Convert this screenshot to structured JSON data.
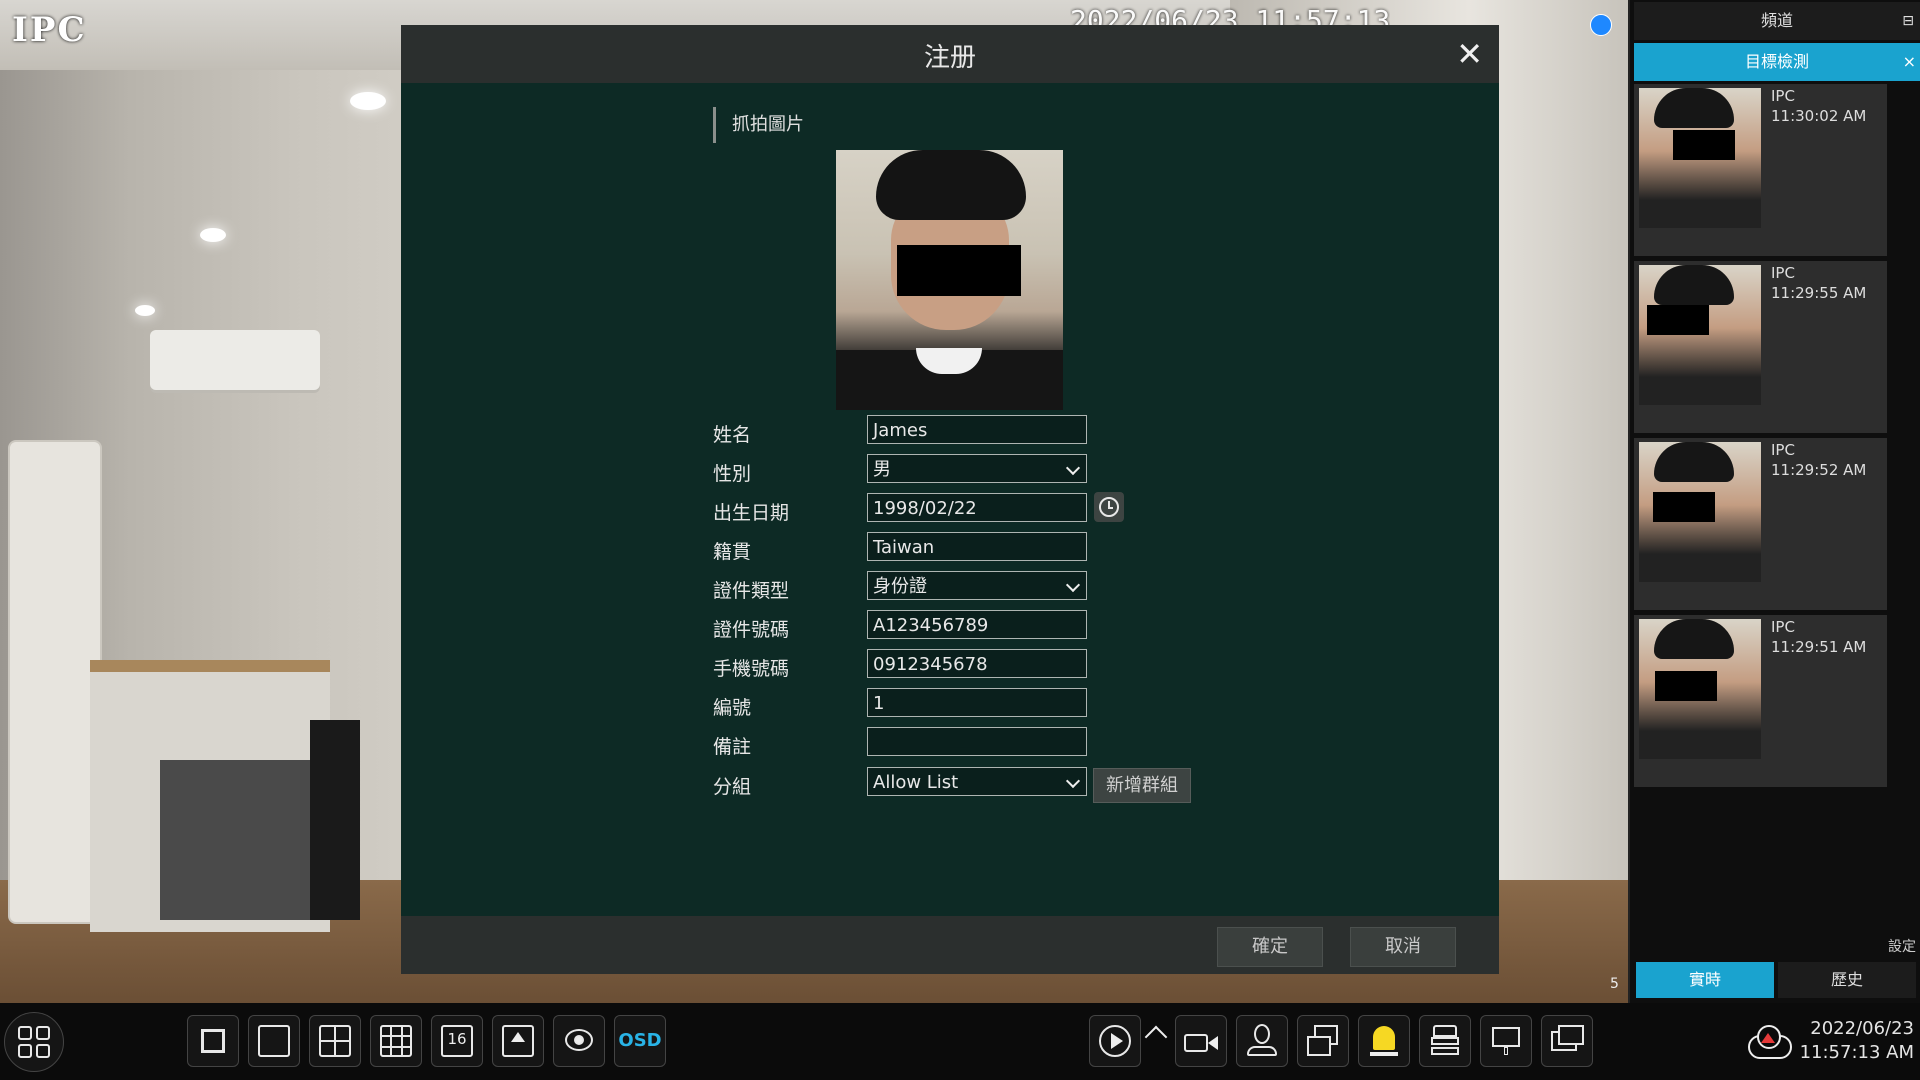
{
  "camera": {
    "label": "IPC",
    "timestamp": "2022/06/23 11:57:13",
    "channel_number": "5"
  },
  "dialog": {
    "title": "注册",
    "close": "✕",
    "section": "抓拍圖片",
    "fields": {
      "name": {
        "label": "姓名",
        "value": "James"
      },
      "gender": {
        "label": "性別",
        "value": "男"
      },
      "birth": {
        "label": "出生日期",
        "value": "1998/02/22"
      },
      "origin": {
        "label": "籍貫",
        "value": "Taiwan"
      },
      "id_type": {
        "label": "證件類型",
        "value": "身份證"
      },
      "id_number": {
        "label": "證件號碼",
        "value": "A123456789"
      },
      "mobile": {
        "label": "手機號碼",
        "value": "0912345678"
      },
      "number": {
        "label": "編號",
        "value": "1"
      },
      "remark": {
        "label": "備註",
        "value": ""
      },
      "group": {
        "label": "分組",
        "value": "Allow List"
      }
    },
    "add_group": "新增群組",
    "ok": "確定",
    "cancel": "取消"
  },
  "panel": {
    "header": "頻道",
    "tab": "目標檢測",
    "tab_close": "×",
    "captures": [
      {
        "source": "IPC",
        "time": "11:30:02 AM"
      },
      {
        "source": "IPC",
        "time": "11:29:55 AM"
      },
      {
        "source": "IPC",
        "time": "11:29:52 AM"
      },
      {
        "source": "IPC",
        "time": "11:29:51 AM"
      }
    ],
    "settings": "設定",
    "realtime": "實時",
    "history": "歷史"
  },
  "toolbar": {
    "osd": "OSD",
    "grid16": "16",
    "date": "2022/06/23",
    "time": "11:57:13 AM"
  },
  "colors": {
    "accent": "#1aa3cf",
    "dialog_bg": "#0d2a25"
  }
}
